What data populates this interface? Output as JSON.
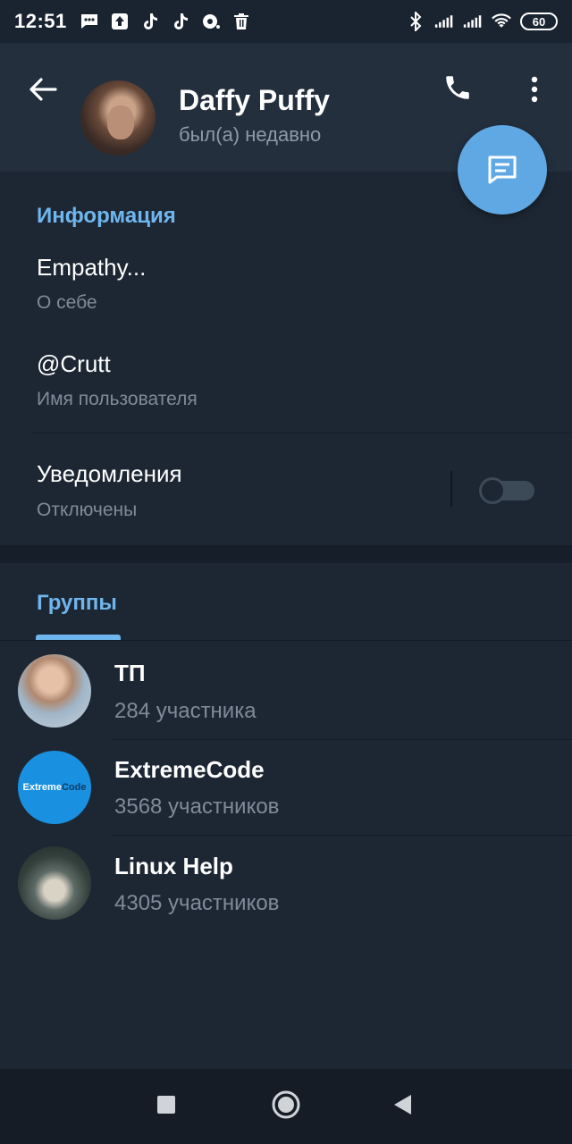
{
  "status_bar": {
    "time": "12:51",
    "battery": "60",
    "notification_icons": [
      "chat-icon",
      "upload-icon",
      "tiktok-icon",
      "tiktok-icon",
      "headset-icon",
      "trash-icon"
    ],
    "system_icons": [
      "bluetooth-icon",
      "signal-icon",
      "signal-icon",
      "wifi-icon"
    ]
  },
  "header": {
    "name": "Daffy Puffy",
    "status": "был(а) недавно"
  },
  "info": {
    "section_title": "Информация",
    "bio": "Empathy...",
    "bio_label": "О себе",
    "username": "@Crutt",
    "username_label": "Имя пользователя",
    "notifications": "Уведомления",
    "notifications_state": "Отключены",
    "notifications_enabled": false
  },
  "groups": {
    "tab_title": "Группы",
    "items": [
      {
        "name": "ТП",
        "members": "284 участника"
      },
      {
        "name": "ExtremeCode",
        "members": "3568 участников"
      },
      {
        "name": "Linux Help",
        "members": "4305 участников"
      }
    ],
    "extremecode_logo": {
      "part1": "Extreme",
      "part2": "Code"
    }
  },
  "colors": {
    "accent": "#6fb6ee",
    "fab": "#5fa8e4",
    "background": "#1d2733",
    "header": "#232f3d"
  }
}
